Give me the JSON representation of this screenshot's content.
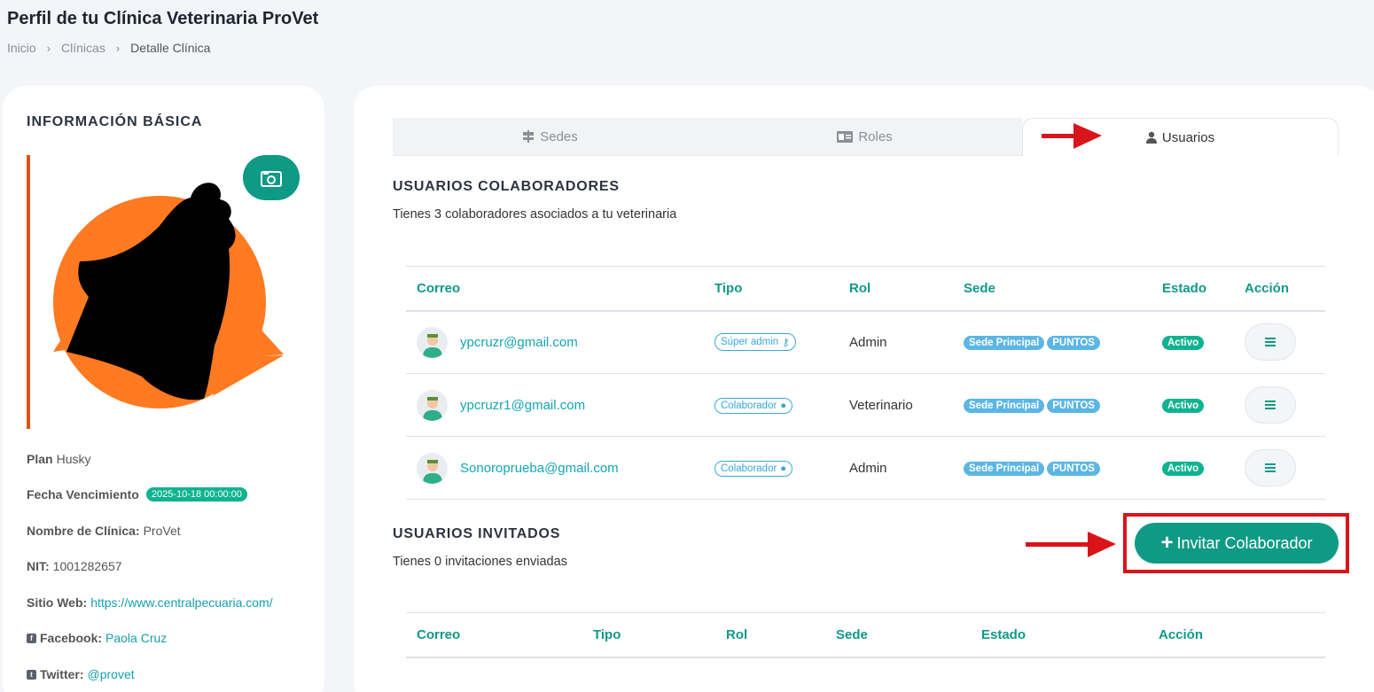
{
  "page": {
    "title": "Perfil de tu Clínica Veterinaria ProVet",
    "breadcrumb": [
      "Inicio",
      "Clínicas",
      "Detalle Clínica"
    ]
  },
  "left": {
    "heading": "INFORMACIÓN BÁSICA",
    "plan_label": "Plan",
    "plan_value": "Husky",
    "expiry_label": "Fecha Vencimiento",
    "expiry_value": "2025-10-18 00:00:00",
    "clinic_label": "Nombre de Clínica:",
    "clinic_value": "ProVet",
    "nit_label": "NIT:",
    "nit_value": "1001282657",
    "web_label": "Sitio Web:",
    "web_value": "https://www.centralpecuaria.com/",
    "facebook_label": "Facebook:",
    "facebook_value": "Paola Cruz",
    "twitter_label": "Twitter:",
    "twitter_value": "@provet"
  },
  "tabs": [
    {
      "label": "Sedes",
      "icon": "signpost-icon"
    },
    {
      "label": "Roles",
      "icon": "id-card-icon"
    },
    {
      "label": "Usuarios",
      "icon": "user-tie-icon",
      "active": true
    }
  ],
  "collaborators": {
    "title": "USUARIOS COLABORADORES",
    "subtitle": "Tienes 3 colaboradores asociados a tu veterinaria",
    "headers": [
      "Correo",
      "Tipo",
      "Rol",
      "Sede",
      "Estado",
      "Acción"
    ],
    "rows": [
      {
        "email": "ypcruzr@gmail.com",
        "type": "Súper admin",
        "role": "Admin",
        "sede": "Sede Principal",
        "extra": "PUNTOS",
        "status": "Activo"
      },
      {
        "email": "ypcruzr1@gmail.com",
        "type": "Colaborador",
        "role": "Veterinario",
        "sede": "Sede Principal",
        "extra": "PUNTOS",
        "status": "Activo"
      },
      {
        "email": "Sonoroprueba@gmail.com",
        "type": "Colaborador",
        "role": "Admin",
        "sede": "Sede Principal",
        "extra": "PUNTOS",
        "status": "Activo"
      }
    ]
  },
  "invited": {
    "title": "USUARIOS INVITADOS",
    "subtitle": "Tienes 0 invitaciones enviadas",
    "headers": [
      "Correo",
      "Tipo",
      "Rol",
      "Sede",
      "Estado",
      "Acción"
    ],
    "invite_button": "Invitar Colaborador"
  },
  "colors": {
    "accent": "#0f9a86",
    "link": "#13a5b5",
    "badge_blue": "#5bb6e6",
    "status_green": "#0fb38f",
    "annotation_red": "#d9141b"
  }
}
